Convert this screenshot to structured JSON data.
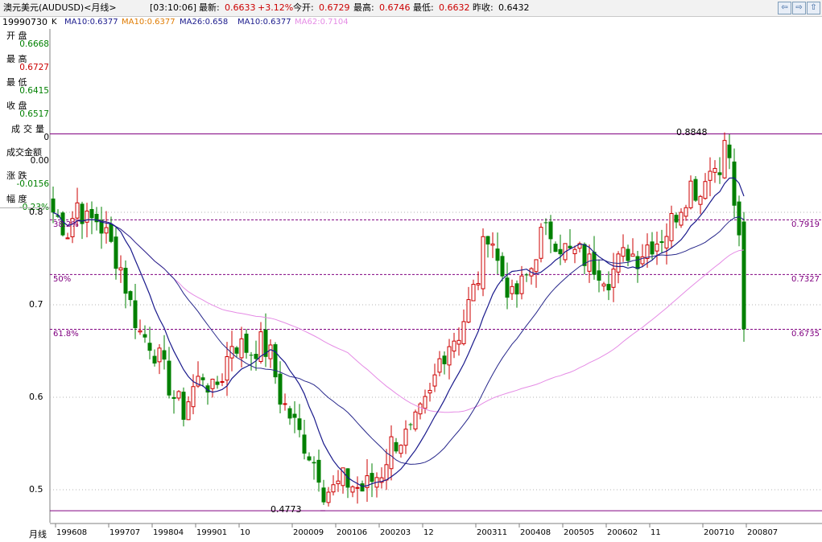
{
  "header": {
    "title": "澳元美元(AUDUSD)<月线>",
    "time": "[03:10:06]",
    "latest_label": "最新:",
    "latest_value": "0.6633",
    "change": "+3.12%",
    "open_label": "今开:",
    "open_value": "0.6729",
    "high_label": "最高:",
    "high_value": "0.6746",
    "low_label": "最低:",
    "low_value": "0.6632",
    "prev_label": "昨收:",
    "prev_value": "0.6432",
    "nav": [
      "⇦",
      "⇨",
      "⇧"
    ]
  },
  "ma_legend": {
    "date": "19990730",
    "k": "K",
    "ma1": "MA10:0.6377",
    "ma2": "MA10:0.6377",
    "ma3": "MA26:0.658",
    "ma4": "MA10:0.6377",
    "ma5": "MA62:0.7104"
  },
  "info_panel": [
    {
      "label": "开  盘",
      "value": "0.6668",
      "color": "#008000"
    },
    {
      "label": "最  高",
      "value": "0.6727",
      "color": "#cc0000"
    },
    {
      "label": "最  低",
      "value": "0.6415",
      "color": "#008000"
    },
    {
      "label": "收  盘",
      "value": "0.6517",
      "color": "#008000"
    },
    {
      "label": "成交量",
      "value": "0",
      "color": "#000000"
    },
    {
      "label": "成交金额",
      "value": "0.00",
      "color": "#000000"
    },
    {
      "label": "涨  跌",
      "value": "-0.0156",
      "color": "#008000"
    },
    {
      "label": "幅  度",
      "value": "-0.23%",
      "color": "#008000"
    }
  ],
  "colors": {
    "up": "#cc0000",
    "down": "#008000",
    "ma_short": "#1a1a8c",
    "ma_mid": "#26268a",
    "ma_long": "#e58be5",
    "fib": "#800080",
    "grid": "#b3b3b3"
  },
  "chart_data": {
    "type": "candlestick",
    "period": "月线",
    "ylim": [
      0.48,
      0.855
    ],
    "y_ticks": [
      "0.8",
      "0.7",
      "0.6",
      "0.5"
    ],
    "y_tick_values": [
      0.8,
      0.7,
      0.6,
      0.5
    ],
    "x_ticks": [
      {
        "label": "199608",
        "index": 1
      },
      {
        "label": "199707",
        "index": 12
      },
      {
        "label": "199804",
        "index": 21
      },
      {
        "label": "199901",
        "index": 30
      },
      {
        "label": "10",
        "index": 39
      },
      {
        "label": "200009",
        "index": 50
      },
      {
        "label": "200106",
        "index": 59
      },
      {
        "label": "200203",
        "index": 68
      },
      {
        "label": "12",
        "index": 77
      },
      {
        "label": "200311",
        "index": 88
      },
      {
        "label": "200408",
        "index": 97
      },
      {
        "label": "200505",
        "index": 106
      },
      {
        "label": "200602",
        "index": 115
      },
      {
        "label": "11",
        "index": 124
      },
      {
        "label": "200710",
        "index": 135
      },
      {
        "label": "200807",
        "index": 144
      }
    ],
    "fib_levels": [
      {
        "label": "38.2%",
        "right": "0.7919",
        "value": 0.7919
      },
      {
        "label": "50%",
        "right": "0.7327",
        "value": 0.7327
      },
      {
        "label": "61.8%",
        "right": "0.6735",
        "value": 0.6735
      }
    ],
    "range_lines": [
      0.8848,
      0.4773
    ],
    "annotations": [
      {
        "text": "0.8848",
        "index": 139,
        "value": 0.8848
      },
      {
        "text": "0.4773",
        "index": 55,
        "value": 0.4773
      }
    ],
    "anchors": [
      [
        0,
        0.8
      ],
      [
        3,
        0.78
      ],
      [
        5,
        0.81
      ],
      [
        7,
        0.79
      ],
      [
        9,
        0.792
      ],
      [
        11,
        0.775
      ],
      [
        14,
        0.74
      ],
      [
        16,
        0.7
      ],
      [
        18,
        0.67
      ],
      [
        20,
        0.66
      ],
      [
        22,
        0.64
      ],
      [
        25,
        0.6
      ],
      [
        27,
        0.585
      ],
      [
        29,
        0.61
      ],
      [
        31,
        0.625
      ],
      [
        33,
        0.605
      ],
      [
        35,
        0.625
      ],
      [
        37,
        0.66
      ],
      [
        39,
        0.655
      ],
      [
        41,
        0.65
      ],
      [
        43,
        0.658
      ],
      [
        45,
        0.645
      ],
      [
        47,
        0.6
      ],
      [
        49,
        0.58
      ],
      [
        51,
        0.56
      ],
      [
        53,
        0.54
      ],
      [
        55,
        0.52
      ],
      [
        56,
        0.5
      ],
      [
        58,
        0.5
      ],
      [
        60,
        0.51
      ],
      [
        62,
        0.505
      ],
      [
        64,
        0.5
      ],
      [
        66,
        0.51
      ],
      [
        68,
        0.52
      ],
      [
        70,
        0.55
      ],
      [
        72,
        0.555
      ],
      [
        74,
        0.56
      ],
      [
        76,
        0.58
      ],
      [
        78,
        0.6
      ],
      [
        80,
        0.64
      ],
      [
        82,
        0.66
      ],
      [
        84,
        0.67
      ],
      [
        86,
        0.7
      ],
      [
        88,
        0.73
      ],
      [
        89,
        0.76
      ],
      [
        90,
        0.78
      ],
      [
        91,
        0.77
      ],
      [
        92,
        0.745
      ],
      [
        94,
        0.72
      ],
      [
        95,
        0.705
      ],
      [
        97,
        0.72
      ],
      [
        99,
        0.74
      ],
      [
        100,
        0.76
      ],
      [
        101,
        0.775
      ],
      [
        103,
        0.778
      ],
      [
        105,
        0.765
      ],
      [
        107,
        0.755
      ],
      [
        109,
        0.755
      ],
      [
        111,
        0.745
      ],
      [
        113,
        0.74
      ],
      [
        115,
        0.73
      ],
      [
        117,
        0.745
      ],
      [
        119,
        0.758
      ],
      [
        121,
        0.752
      ],
      [
        123,
        0.765
      ],
      [
        125,
        0.77
      ],
      [
        127,
        0.78
      ],
      [
        128,
        0.79
      ],
      [
        130,
        0.81
      ],
      [
        132,
        0.83
      ],
      [
        134,
        0.82
      ],
      [
        135,
        0.845
      ],
      [
        136,
        0.845
      ],
      [
        138,
        0.855
      ],
      [
        139,
        0.87
      ],
      [
        140,
        0.86
      ],
      [
        141,
        0.8
      ],
      [
        142,
        0.78
      ],
      [
        143,
        0.6735
      ]
    ]
  },
  "axis_label": "月线"
}
